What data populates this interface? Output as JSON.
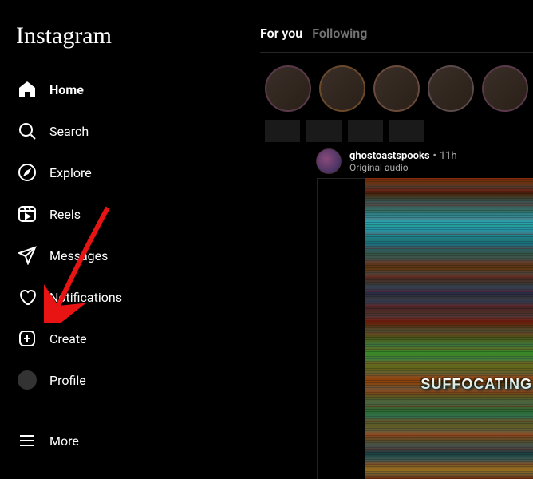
{
  "brand": "Instagram",
  "sidebar": {
    "items": [
      {
        "label": "Home",
        "icon": "home",
        "active": true
      },
      {
        "label": "Search",
        "icon": "search",
        "active": false
      },
      {
        "label": "Explore",
        "icon": "compass",
        "active": false
      },
      {
        "label": "Reels",
        "icon": "reels",
        "active": false
      },
      {
        "label": "Messages",
        "icon": "send",
        "active": false
      },
      {
        "label": "Notifications",
        "icon": "heart",
        "active": false
      },
      {
        "label": "Create",
        "icon": "plus-square",
        "active": false
      },
      {
        "label": "Profile",
        "icon": "profile",
        "active": false
      }
    ],
    "more": {
      "label": "More",
      "icon": "menu"
    }
  },
  "tabs": {
    "for_you": "For you",
    "following": "Following",
    "active": "for_you"
  },
  "post": {
    "username": "ghostoastspooks",
    "separator": "•",
    "time": "11h",
    "audio": "Original audio",
    "caption_overlay": "SUFFOCATING FE"
  },
  "annotation": {
    "arrow_target": "create"
  }
}
